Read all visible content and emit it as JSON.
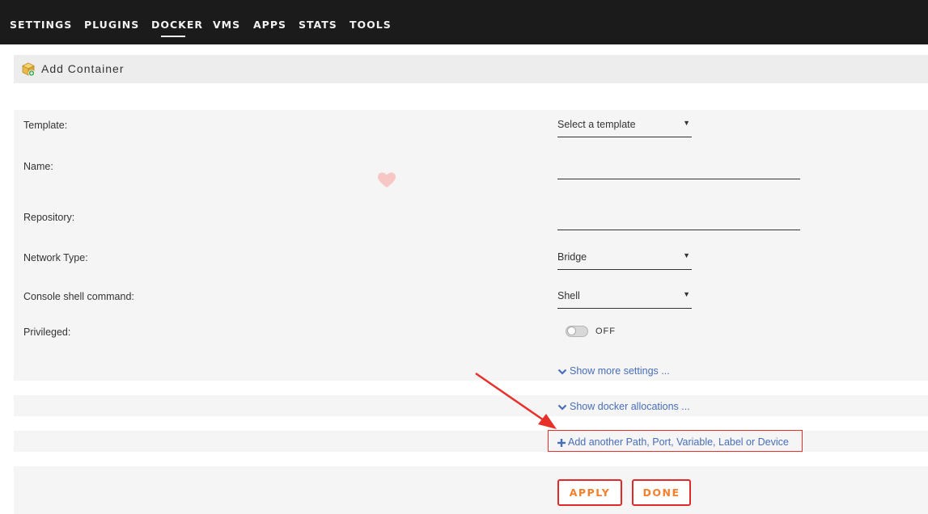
{
  "nav": {
    "items": [
      {
        "label": "SETTINGS"
      },
      {
        "label": "PLUGINS"
      },
      {
        "label": "DOCKER",
        "active": true
      },
      {
        "label": "VMS"
      },
      {
        "label": "APPS"
      },
      {
        "label": "STATS"
      },
      {
        "label": "TOOLS"
      }
    ]
  },
  "page": {
    "title": "Add Container",
    "icon": "docker-container-icon"
  },
  "form": {
    "template": {
      "label": "Template:",
      "value": "Select a template"
    },
    "name": {
      "label": "Name:",
      "value": ""
    },
    "repository": {
      "label": "Repository:",
      "value": ""
    },
    "network_type": {
      "label": "Network Type:",
      "value": "Bridge"
    },
    "console_shell": {
      "label": "Console shell command:",
      "value": "Shell"
    },
    "privileged": {
      "label": "Privileged:",
      "state": "OFF"
    }
  },
  "links": {
    "show_more_settings": "Show more settings ...",
    "show_docker_allocations": "Show docker allocations ...",
    "add_another": "Add another Path, Port, Variable, Label or Device"
  },
  "buttons": {
    "apply": "APPLY",
    "done": "DONE"
  },
  "colors": {
    "nav_bg": "#1c1b1b",
    "link": "#486dba",
    "button_border": "#e22828",
    "button_text": "#f57f2c",
    "annotation_red": "#e8302b"
  }
}
